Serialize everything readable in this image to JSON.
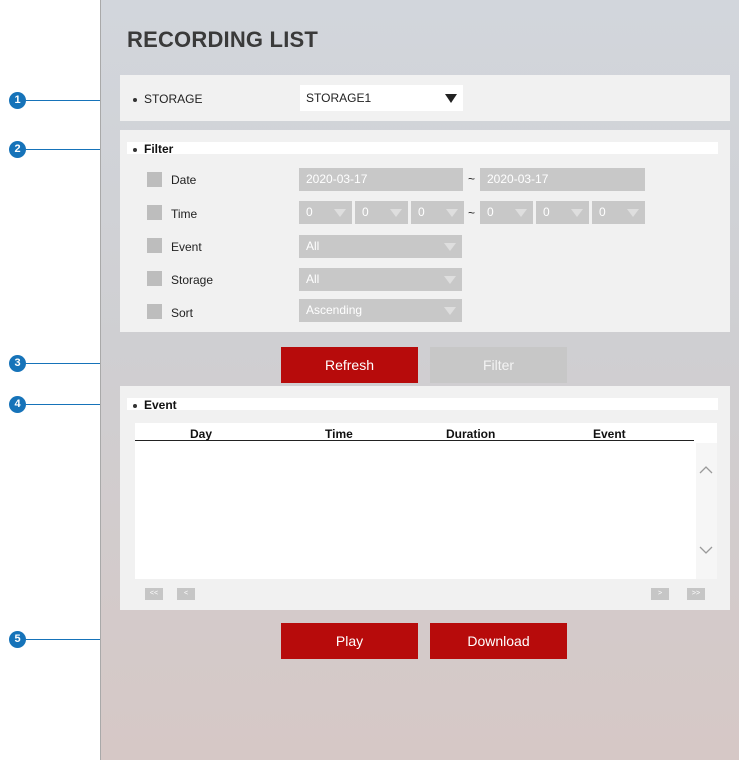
{
  "page_title": "RECORDING LIST",
  "storage": {
    "label": "STORAGE",
    "selected": "STORAGE1"
  },
  "filter": {
    "header": "Filter",
    "date": {
      "label": "Date",
      "from": "2020-03-17",
      "to": "2020-03-17"
    },
    "time": {
      "label": "Time",
      "from": [
        "0",
        "0",
        "0"
      ],
      "to": [
        "0",
        "0",
        "0"
      ]
    },
    "event": {
      "label": "Event",
      "selected": "All"
    },
    "storage": {
      "label": "Storage",
      "selected": "All"
    },
    "sort": {
      "label": "Sort",
      "selected": "Ascending"
    },
    "range_separator": "~"
  },
  "buttons": {
    "refresh": "Refresh",
    "filter": "Filter",
    "play": "Play",
    "download": "Download"
  },
  "event_list": {
    "header": "Event",
    "columns": [
      "Day",
      "Time",
      "Duration",
      "Event"
    ],
    "rows": [],
    "pager": {
      "first": "<<",
      "prev": "<",
      "next": ">",
      "last": ">>"
    }
  },
  "callouts": [
    "1",
    "2",
    "3",
    "4",
    "5"
  ],
  "colors": {
    "accent": "#b70b0b",
    "callout": "#1673b9"
  },
  "icons": {
    "dropdown": "triangle-down",
    "scroll_up": "chevron-up",
    "scroll_down": "chevron-down"
  }
}
